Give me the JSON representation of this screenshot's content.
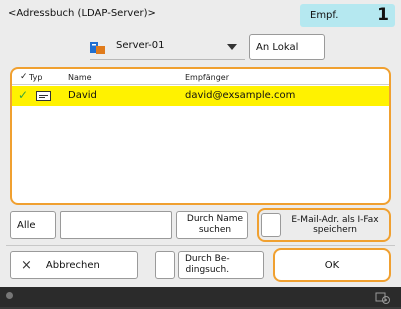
{
  "title": "<Adressbuch (LDAP-Server)>",
  "recipient_badge": {
    "label": "Empf.",
    "count": "1"
  },
  "server_select": {
    "value": "Server-01"
  },
  "local_button": "An Lokal",
  "table": {
    "headers": [
      "Typ",
      "Name",
      "Empfänger"
    ],
    "rows": [
      {
        "checked": true,
        "type_icon": "address-card-icon",
        "name": "David",
        "recipient": "david@exsample.com",
        "selected": true
      }
    ]
  },
  "search": {
    "all_button": "Alle",
    "input_value": "",
    "search_by_name_button": "Durch Name suchen",
    "save_ifax_button": "E-Mail-Adr. als I-Fax speichern"
  },
  "footer": {
    "cancel_button": "Abbrechen",
    "condition_search_button": "Durch Be-\ndingsuch.",
    "ok_button": "OK"
  },
  "colors": {
    "highlight": "#fff200",
    "accent_border": "#f0a030",
    "badge_bg": "#b5e8f0",
    "check": "#3aa53a"
  }
}
